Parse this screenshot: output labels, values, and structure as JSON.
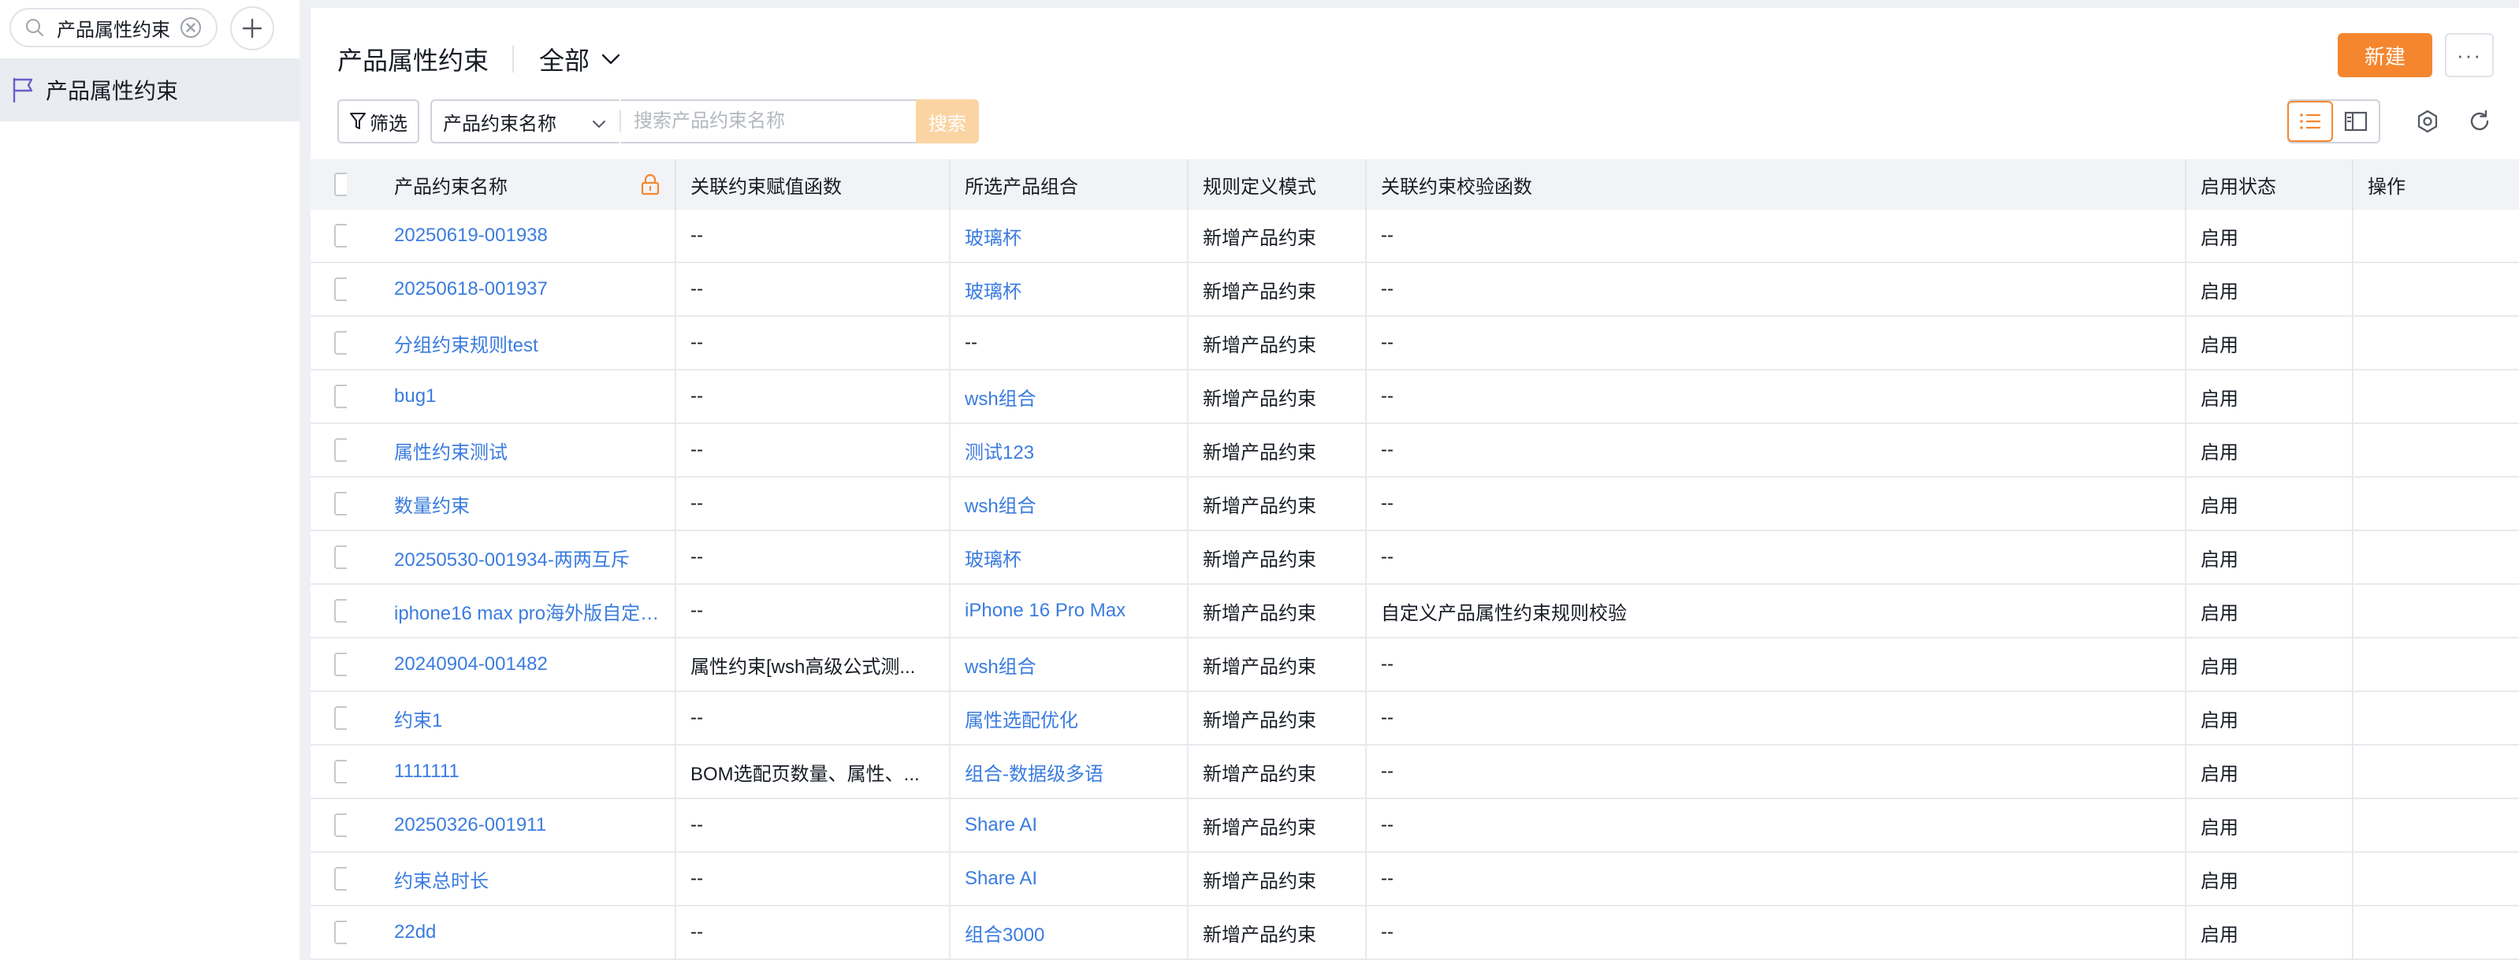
{
  "sidebar": {
    "search_value": "产品属性约束",
    "item_label": "产品属性约束"
  },
  "header": {
    "title": "产品属性约束",
    "scope": "全部",
    "new_label": "新建",
    "more_label": "···"
  },
  "toolbar": {
    "filter_label": "筛选",
    "field_label": "产品约束名称",
    "search_placeholder": "搜索产品约束名称",
    "search_label": "搜索"
  },
  "table": {
    "columns": [
      "产品约束名称",
      "关联约束赋值函数",
      "所选产品组合",
      "规则定义模式",
      "关联约束校验函数",
      "启用状态",
      "操作"
    ],
    "rows": [
      {
        "name": "20250619-001938",
        "assign": "--",
        "combo": "玻璃杯",
        "mode": "新增产品约束",
        "check": "--",
        "status": "启用"
      },
      {
        "name": "20250618-001937",
        "assign": "--",
        "combo": "玻璃杯",
        "mode": "新增产品约束",
        "check": "--",
        "status": "启用"
      },
      {
        "name": "分组约束规则test",
        "assign": "--",
        "combo": "--",
        "mode": "新增产品约束",
        "check": "--",
        "status": "启用"
      },
      {
        "name": "bug1",
        "assign": "--",
        "combo": "wsh组合",
        "mode": "新增产品约束",
        "check": "--",
        "status": "启用"
      },
      {
        "name": "属性约束测试",
        "assign": "--",
        "combo": "测试123",
        "mode": "新增产品约束",
        "check": "--",
        "status": "启用"
      },
      {
        "name": "数量约束",
        "assign": "--",
        "combo": "wsh组合",
        "mode": "新增产品约束",
        "check": "--",
        "status": "启用"
      },
      {
        "name": "20250530-001934-两两互斥",
        "assign": "--",
        "combo": "玻璃杯",
        "mode": "新增产品约束",
        "check": "--",
        "status": "启用"
      },
      {
        "name": "iphone16 max pro海外版自定义属...",
        "assign": "--",
        "combo": "iPhone 16 Pro Max",
        "mode": "新增产品约束",
        "check": "自定义产品属性约束规则校验",
        "status": "启用"
      },
      {
        "name": "20240904-001482",
        "assign": "属性约束[wsh高级公式测...",
        "combo": "wsh组合",
        "mode": "新增产品约束",
        "check": "--",
        "status": "启用"
      },
      {
        "name": "约束1",
        "assign": "--",
        "combo": "属性选配优化",
        "mode": "新增产品约束",
        "check": "--",
        "status": "启用"
      },
      {
        "name": "1111111",
        "assign": "BOM选配页数量、属性、...",
        "combo": "组合-数据级多语",
        "mode": "新增产品约束",
        "check": "--",
        "status": "启用"
      },
      {
        "name": "20250326-001911",
        "assign": "--",
        "combo": "Share AI",
        "mode": "新增产品约束",
        "check": "--",
        "status": "启用"
      },
      {
        "name": "约束总时长",
        "assign": "--",
        "combo": "Share AI",
        "mode": "新增产品约束",
        "check": "--",
        "status": "启用"
      },
      {
        "name": "22dd",
        "assign": "--",
        "combo": "组合3000",
        "mode": "新增产品约束",
        "check": "--",
        "status": "启用"
      }
    ]
  },
  "colors": {
    "accent": "#f5862e",
    "link": "#3b7cdf",
    "search_disabled": "#fbd4a4",
    "sidebar_active": "#e9ecf1"
  },
  "icons": [
    "search-icon",
    "clear-icon",
    "plus-icon",
    "flag-icon",
    "chevron-down-icon",
    "filter-icon",
    "list-view-icon",
    "split-view-icon",
    "settings-icon",
    "refresh-icon",
    "lock-icon"
  ]
}
